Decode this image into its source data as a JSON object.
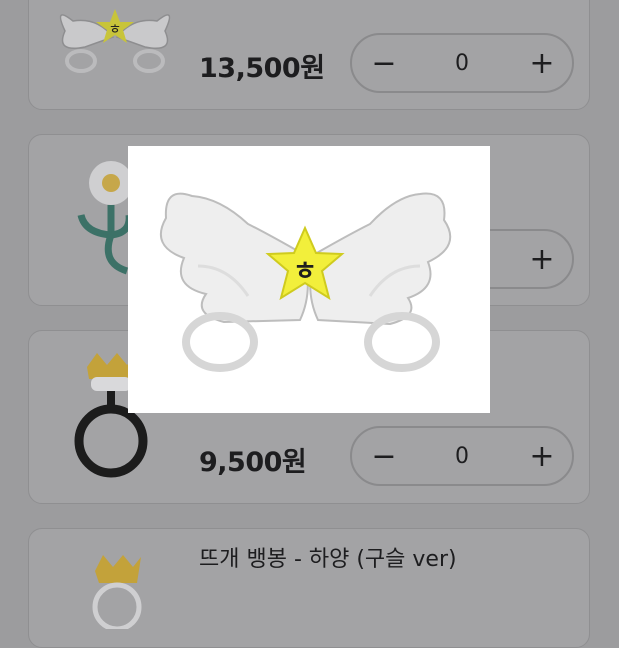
{
  "products": [
    {
      "name": "",
      "price": "13,500원",
      "quantity": "0",
      "image_icon": "angel-wings-keyring-icon"
    },
    {
      "name": "",
      "price": "",
      "quantity": "",
      "image_icon": "flower-keyring-icon"
    },
    {
      "name": "",
      "price": "9,500원",
      "quantity": "0",
      "image_icon": "crown-ring-keyring-icon"
    },
    {
      "name": "뜨개 뱅봉 - 하양 (구슬 ver)",
      "price": "",
      "quantity": "",
      "image_icon": "crown-bead-keyring-icon"
    }
  ],
  "stepper": {
    "minus_label": "−",
    "plus_label": "+"
  },
  "popup": {
    "image_icon": "angel-wings-keyring-icon",
    "badge_letter": "ㅎ"
  },
  "colors": {
    "overlay": "#9c9c9e",
    "card": "#a3a3a5",
    "popup_background": "#ffffff",
    "star": "#f2ef3b"
  }
}
